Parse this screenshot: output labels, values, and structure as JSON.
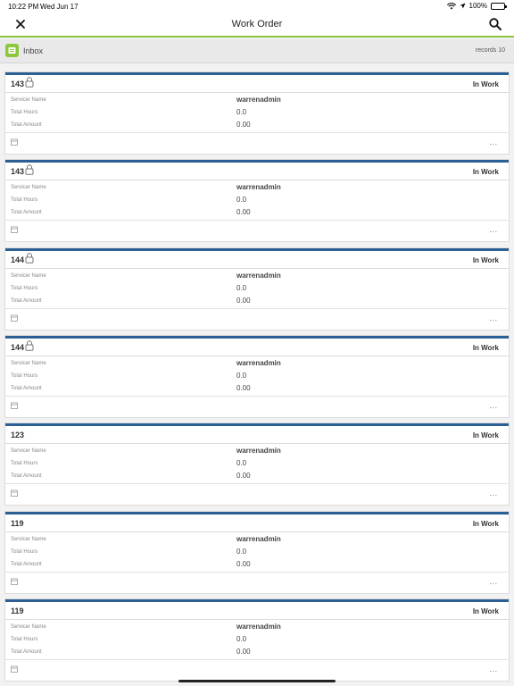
{
  "status_bar": {
    "time": "10:22 PM",
    "date": "Wed Jun 17",
    "battery": "100%",
    "battery_level": 1.0
  },
  "nav": {
    "title": "Work Order"
  },
  "inbox": {
    "label": "Inbox",
    "records": "records 10"
  },
  "labels": {
    "servicer_name": "Servicer Name",
    "total_hours": "Total Hours",
    "total_amount": "Total Amount",
    "more": "..."
  },
  "colors": {
    "accent_green": "#8dc63f",
    "card_top": "#2c5f93"
  },
  "work_orders": [
    {
      "number": "143",
      "locked": true,
      "status": "In Work",
      "servicer": "warrenadmin",
      "hours": "0.0",
      "amount": "0.00"
    },
    {
      "number": "143",
      "locked": true,
      "status": "In Work",
      "servicer": "warrenadmin",
      "hours": "0.0",
      "amount": "0.00"
    },
    {
      "number": "144",
      "locked": true,
      "status": "In Work",
      "servicer": "warrenadmin",
      "hours": "0.0",
      "amount": "0.00"
    },
    {
      "number": "144",
      "locked": true,
      "status": "In Work",
      "servicer": "warrenadmin",
      "hours": "0.0",
      "amount": "0.00"
    },
    {
      "number": "123",
      "locked": false,
      "status": "In Work",
      "servicer": "warrenadmin",
      "hours": "0.0",
      "amount": "0.00"
    },
    {
      "number": "119",
      "locked": false,
      "status": "In Work",
      "servicer": "warrenadmin",
      "hours": "0.0",
      "amount": "0.00"
    },
    {
      "number": "119",
      "locked": false,
      "status": "In Work",
      "servicer": "warrenadmin",
      "hours": "0.0",
      "amount": "0.00"
    }
  ]
}
